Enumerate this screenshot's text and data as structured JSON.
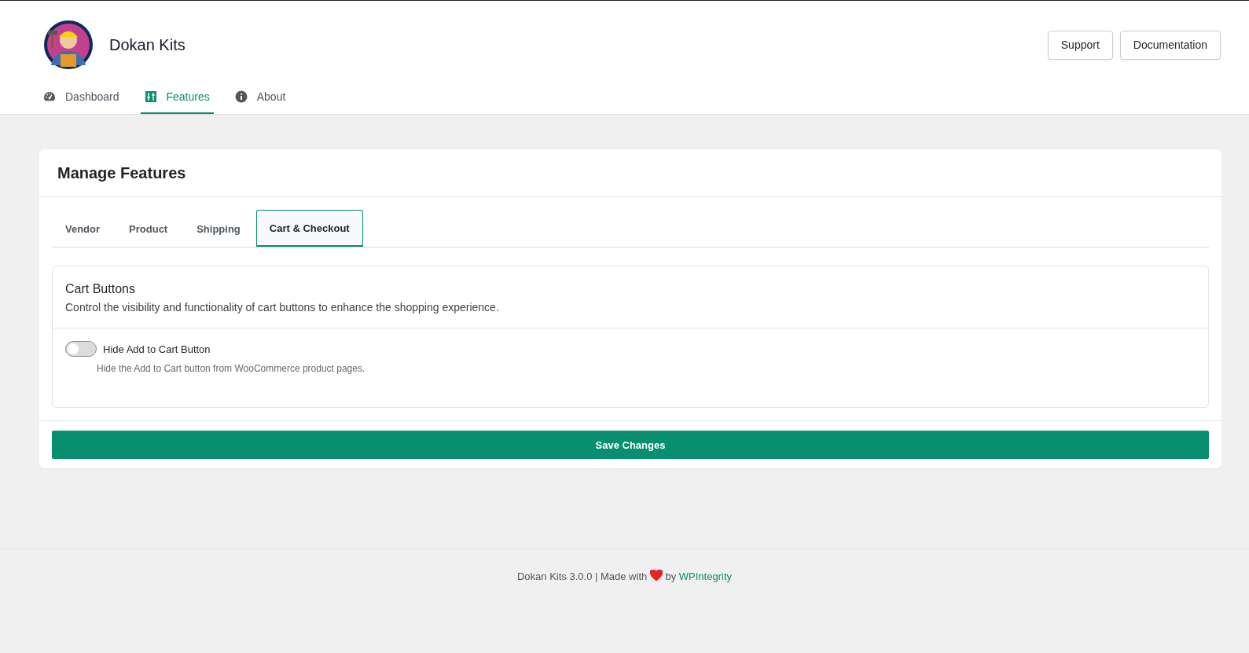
{
  "header": {
    "title": "Dokan Kits",
    "buttons": [
      "Support",
      "Documentation"
    ]
  },
  "nav": [
    {
      "label": "Dashboard",
      "selected": false
    },
    {
      "label": "Features",
      "selected": true
    },
    {
      "label": "About",
      "selected": false
    }
  ],
  "card": {
    "title": "Manage Features",
    "tabs": [
      {
        "label": "Vendor",
        "selected": false
      },
      {
        "label": "Product",
        "selected": false
      },
      {
        "label": "Shipping",
        "selected": false
      },
      {
        "label": "Cart & Checkout",
        "selected": true
      }
    ],
    "section": {
      "title": "Cart Buttons",
      "description": "Control the visibility and functionality of cart buttons to enhance the shopping experience.",
      "settings": [
        {
          "label": "Hide Add to Cart Button",
          "help": "Hide the Add to Cart button from WooCommerce product pages.",
          "on": false
        }
      ]
    },
    "save_button": "Save Changes"
  },
  "footer": {
    "text_before": "Dokan Kits 3.0.0 | Made with",
    "text_after": "by",
    "link": "WPIntegrity"
  }
}
